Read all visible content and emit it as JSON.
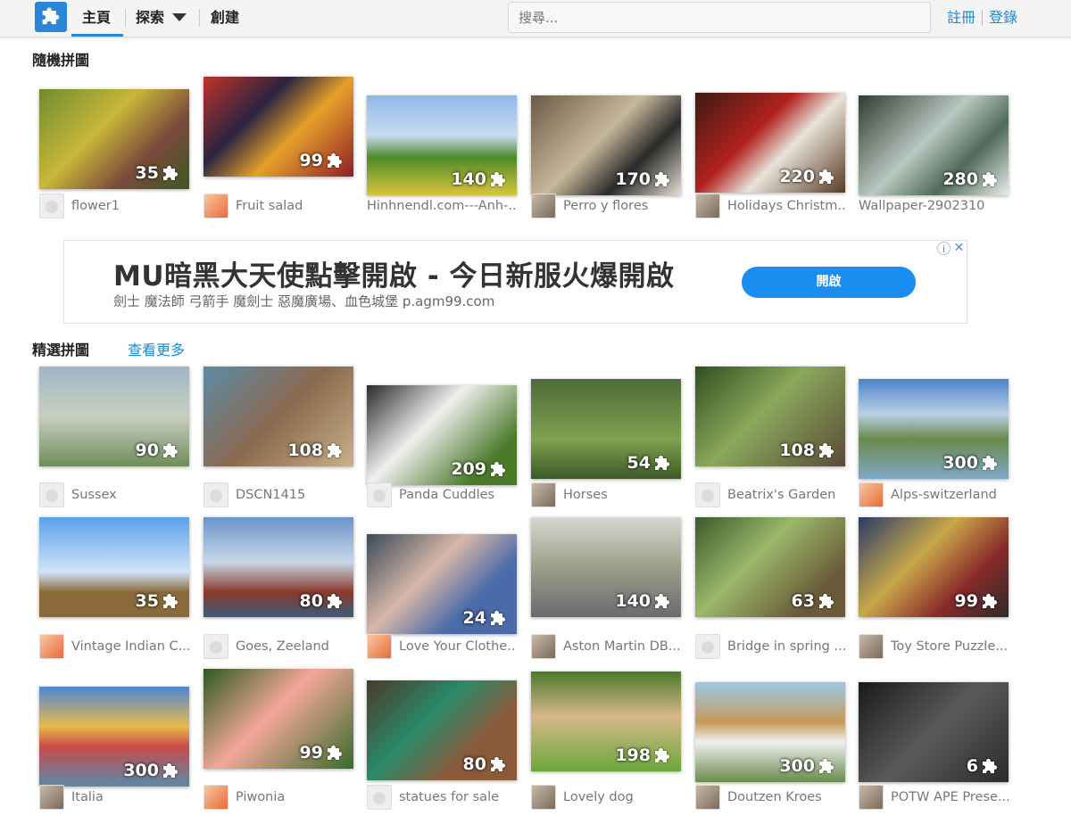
{
  "nav": {
    "home": "主頁",
    "explore": "探索",
    "create": "創建",
    "search_placeholder": "搜尋...",
    "register": "註冊",
    "login": "登錄"
  },
  "sections": {
    "random": "隨機拼圖",
    "featured": "精選拼圖",
    "see_more": "查看更多"
  },
  "ad": {
    "title": "MU暗黑大天使點擊開啟 - 今日新服火爆開啟",
    "subtitle": "劍士 魔法師 弓箭手 魔劍士 惡魔廣場、血色城堡 p.agm99.com",
    "button": "開啟",
    "info_icon": "i",
    "close_icon": "✕"
  },
  "random_puzzles": [
    {
      "count": "35",
      "name": "flower1",
      "avatar": "blank"
    },
    {
      "count": "99",
      "name": "Fruit salad",
      "avatar": "flower"
    },
    {
      "count": "140",
      "name": "Hinhnendl.com---Anh-...",
      "avatar": "none"
    },
    {
      "count": "170",
      "name": "Perro y flores",
      "avatar": "photo"
    },
    {
      "count": "220",
      "name": "Holidays Christm...",
      "avatar": "photo"
    },
    {
      "count": "280",
      "name": "Wallpaper-2902310",
      "avatar": "none"
    }
  ],
  "featured_puzzles": [
    {
      "count": "90",
      "name": "Sussex",
      "avatar": "blank"
    },
    {
      "count": "108",
      "name": "DSCN1415",
      "avatar": "blank"
    },
    {
      "count": "209",
      "name": "Panda Cuddles",
      "avatar": "blank"
    },
    {
      "count": "54",
      "name": "Horses",
      "avatar": "photo"
    },
    {
      "count": "108",
      "name": "Beatrix's Garden",
      "avatar": "blank"
    },
    {
      "count": "300",
      "name": "Alps-switzerland",
      "avatar": "flower"
    },
    {
      "count": "35",
      "name": "Vintage Indian C...",
      "avatar": "flower"
    },
    {
      "count": "80",
      "name": "Goes, Zeeland",
      "avatar": "blank"
    },
    {
      "count": "24",
      "name": "Love Your Clothe...",
      "avatar": "flower"
    },
    {
      "count": "140",
      "name": "Aston Martin DB...",
      "avatar": "photo"
    },
    {
      "count": "63",
      "name": "Bridge in spring ...",
      "avatar": "blank"
    },
    {
      "count": "99",
      "name": "Toy Store Puzzle...",
      "avatar": "photo"
    },
    {
      "count": "300",
      "name": "Italia",
      "avatar": "photo"
    },
    {
      "count": "99",
      "name": "Piwonia",
      "avatar": "flower"
    },
    {
      "count": "80",
      "name": "statues for sale",
      "avatar": "blank"
    },
    {
      "count": "198",
      "name": "Lovely dog",
      "avatar": "photo"
    },
    {
      "count": "300",
      "name": "Doutzen Kroes",
      "avatar": "photo"
    },
    {
      "count": "6",
      "name": "POTW APE Prese...",
      "avatar": "photo"
    }
  ],
  "colors": {
    "accent": "#1b8ad0",
    "logo": "#2a86d8",
    "ad_button": "#1a8ef0"
  }
}
